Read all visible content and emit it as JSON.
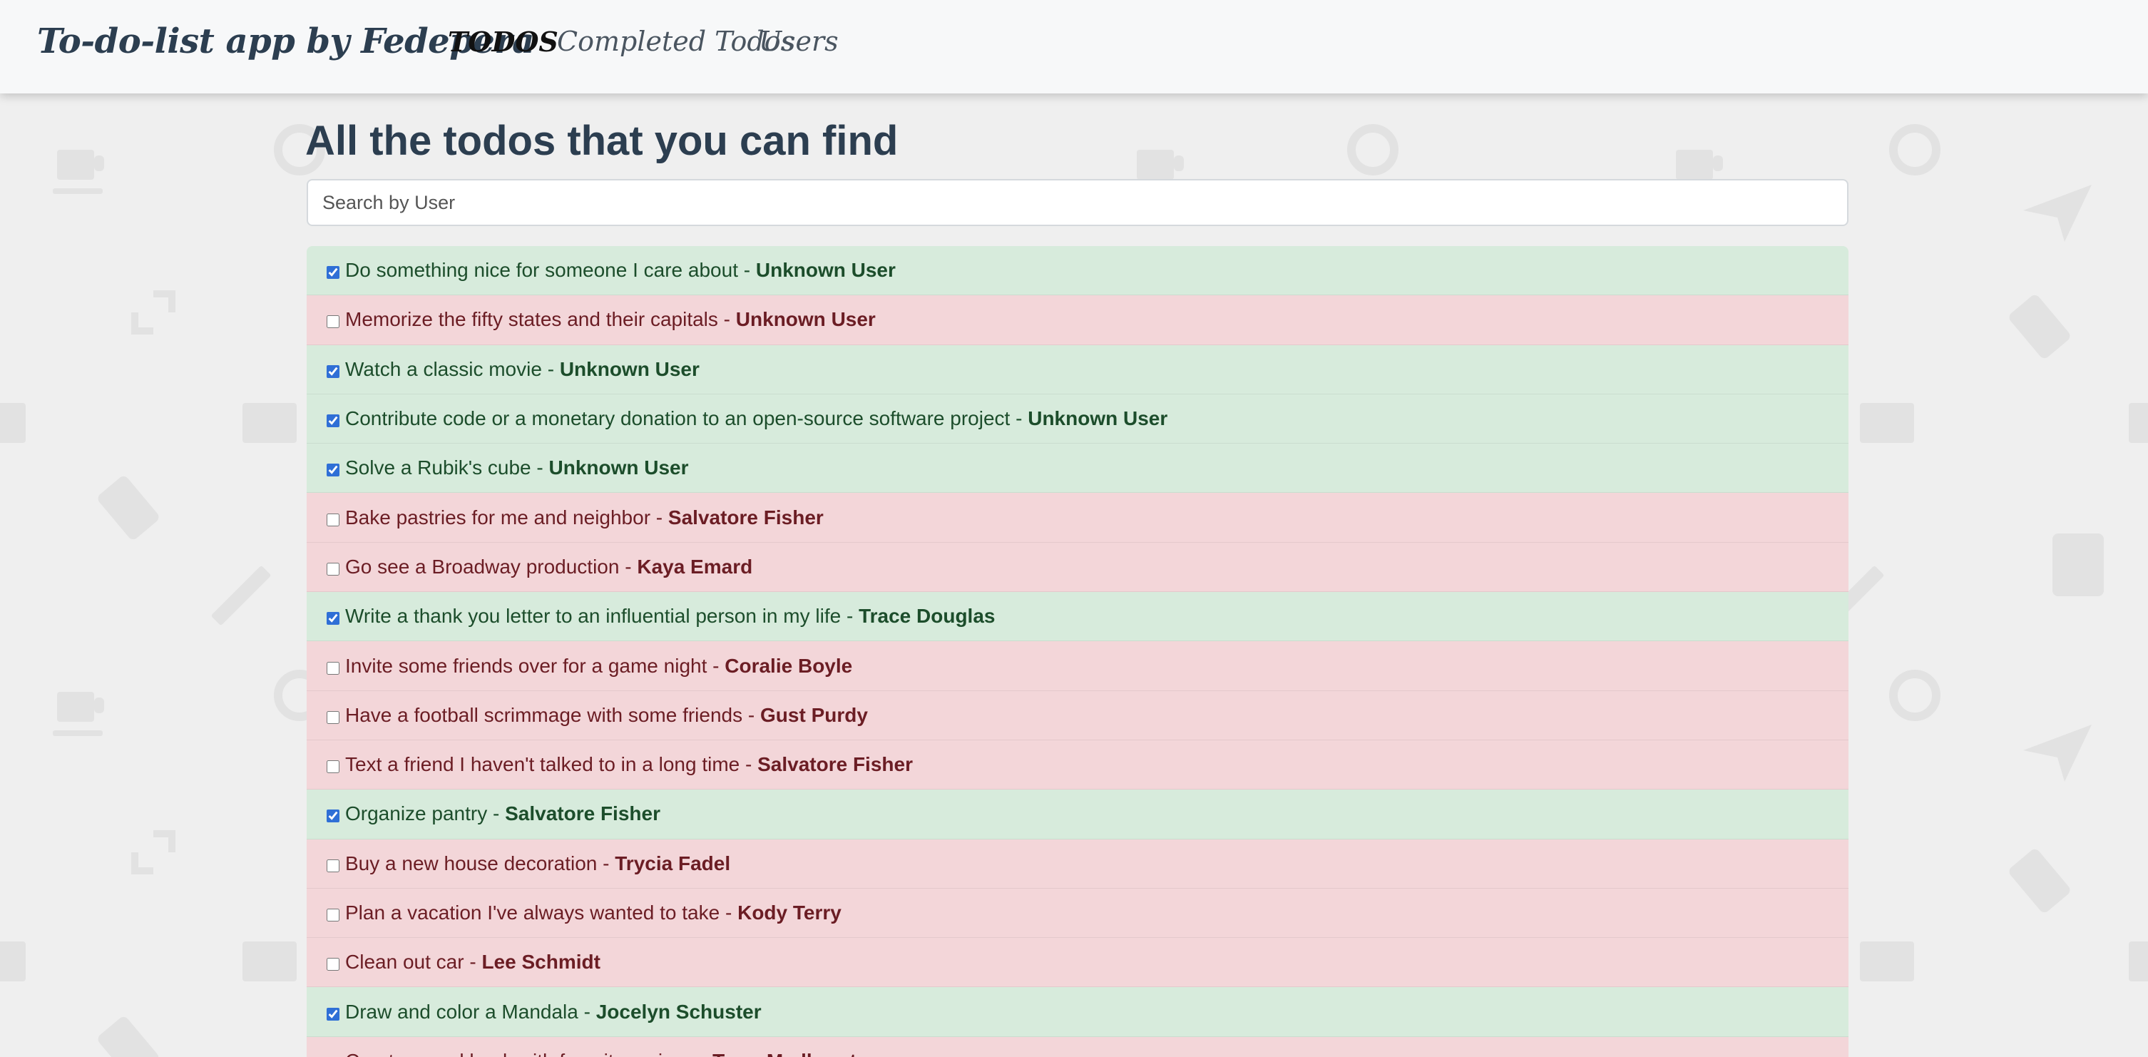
{
  "navbar": {
    "brand": "To-do-list app by Fedepera",
    "links": [
      "TODOS",
      "Completed Todos",
      "Users"
    ]
  },
  "main": {
    "title": "All the todos that you can find",
    "search_placeholder": "Search by User"
  },
  "todos": [
    {
      "text": "Do something nice for someone I care about",
      "separator": " - ",
      "user": "Unknown User",
      "completed": true
    },
    {
      "text": "Memorize the fifty states and their capitals",
      "separator": " - ",
      "user": "Unknown User",
      "completed": false
    },
    {
      "text": "Watch a classic movie",
      "separator": " - ",
      "user": "Unknown User",
      "completed": true
    },
    {
      "text": "Contribute code or a monetary donation to an open-source software project",
      "separator": " - ",
      "user": "Unknown User",
      "completed": true
    },
    {
      "text": "Solve a Rubik's cube",
      "separator": " - ",
      "user": "Unknown User",
      "completed": true
    },
    {
      "text": "Bake pastries for me and neighbor",
      "separator": " - ",
      "user": "Salvatore Fisher",
      "completed": false
    },
    {
      "text": "Go see a Broadway production",
      "separator": " - ",
      "user": "Kaya Emard",
      "completed": false
    },
    {
      "text": "Write a thank you letter to an influential person in my life",
      "separator": " - ",
      "user": "Trace Douglas",
      "completed": true
    },
    {
      "text": "Invite some friends over for a game night",
      "separator": " - ",
      "user": "Coralie Boyle",
      "completed": false
    },
    {
      "text": "Have a football scrimmage with some friends",
      "separator": " - ",
      "user": "Gust Purdy",
      "completed": false
    },
    {
      "text": "Text a friend I haven't talked to in a long time",
      "separator": " - ",
      "user": "Salvatore Fisher",
      "completed": false
    },
    {
      "text": "Organize pantry",
      "separator": " - ",
      "user": "Salvatore Fisher",
      "completed": true
    },
    {
      "text": "Buy a new house decoration",
      "separator": " - ",
      "user": "Trycia Fadel",
      "completed": false
    },
    {
      "text": "Plan a vacation I've always wanted to take",
      "separator": " - ",
      "user": "Kody Terry",
      "completed": false
    },
    {
      "text": "Clean out car",
      "separator": " - ",
      "user": "Lee Schmidt",
      "completed": false
    },
    {
      "text": "Draw and color a Mandala",
      "separator": " - ",
      "user": "Jocelyn Schuster",
      "completed": true
    },
    {
      "text": "Create a cookbook with favorite recipes",
      "separator": " - ",
      "user": "Terry Medhurst",
      "completed": false
    }
  ],
  "colors": {
    "completed_bg": "#d7ebdc",
    "completed_text": "#1c4d2b",
    "pending_bg": "#f3d6d9",
    "pending_text": "#6b1d24",
    "brand": "#2c3e50"
  },
  "background_icons": [
    "coffee-mug-icon",
    "magnifier-icon",
    "send-plane-icon",
    "expand-arrow-icon",
    "phone-icon",
    "mail-icon",
    "pencil-icon",
    "tablet-icon"
  ]
}
